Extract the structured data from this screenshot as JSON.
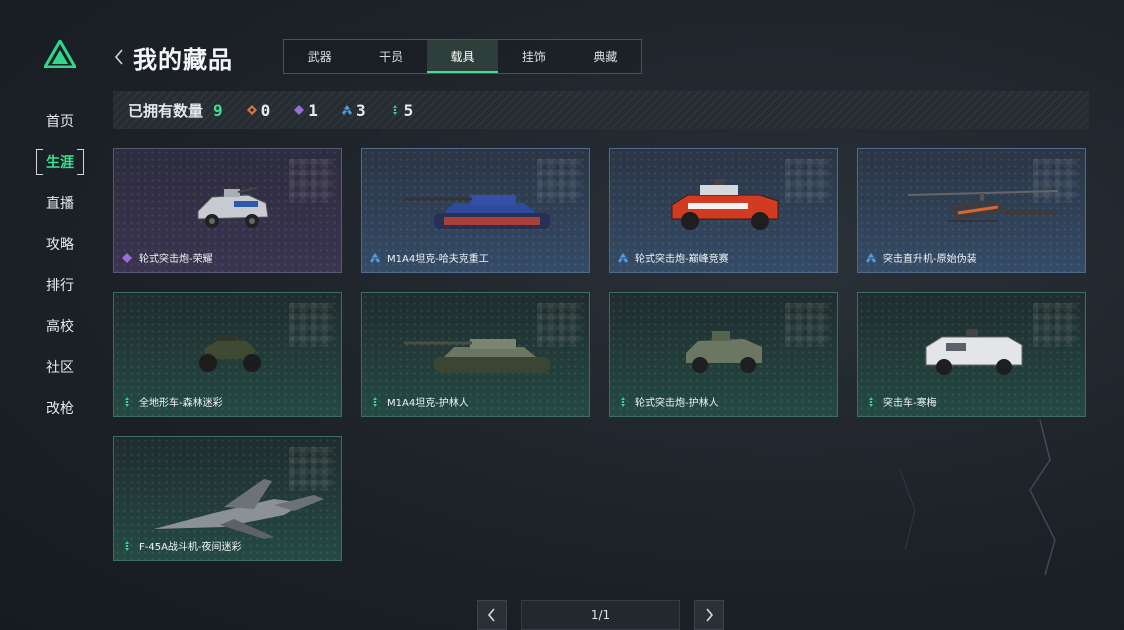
{
  "nav": {
    "items": [
      "首页",
      "生涯",
      "直播",
      "攻略",
      "排行",
      "高校",
      "社区",
      "改枪"
    ],
    "active": "生涯"
  },
  "header": {
    "title": "我的藏品"
  },
  "tabs": {
    "items": [
      "武器",
      "干员",
      "载具",
      "挂饰",
      "典藏"
    ],
    "active": "载具"
  },
  "stats": {
    "label": "已拥有数量",
    "total": "9",
    "rarity_counts": [
      {
        "icon": "orange-gem-icon",
        "color": "#e0743f",
        "count": "0"
      },
      {
        "icon": "purple-gem-icon",
        "color": "#9a6ed8",
        "count": "1"
      },
      {
        "icon": "blue-gem-icon",
        "color": "#4d9be0",
        "count": "3"
      },
      {
        "icon": "green-gem-icon",
        "color": "#36d38a",
        "count": "5"
      }
    ]
  },
  "items": [
    {
      "name": "轮式突击炮-荣耀",
      "rarity": "purple",
      "icon": "armored-car-icon"
    },
    {
      "name": "M1A4坦克-哈夫克重工",
      "rarity": "blue",
      "icon": "tank-icon"
    },
    {
      "name": "轮式突击炮-巅峰竞赛",
      "rarity": "blue",
      "icon": "armored-car-icon"
    },
    {
      "name": "突击直升机-原始伪装",
      "rarity": "blue",
      "icon": "helicopter-icon"
    },
    {
      "name": "全地形车-森林迷彩",
      "rarity": "green",
      "icon": "atv-icon"
    },
    {
      "name": "M1A4坦克-护林人",
      "rarity": "green",
      "icon": "tank-icon"
    },
    {
      "name": "轮式突击炮-护林人",
      "rarity": "green",
      "icon": "armored-car-icon"
    },
    {
      "name": "突击车-寒梅",
      "rarity": "green",
      "icon": "assault-vehicle-icon"
    },
    {
      "name": "F-45A战斗机-夜间迷彩",
      "rarity": "green",
      "icon": "fighter-jet-icon"
    }
  ],
  "pagination": {
    "text": "1/1"
  },
  "colors": {
    "accent": "#3ce08e",
    "purple": "#9a6ed8",
    "blue": "#4d9be0",
    "green": "#36d38a",
    "orange": "#e0743f"
  }
}
